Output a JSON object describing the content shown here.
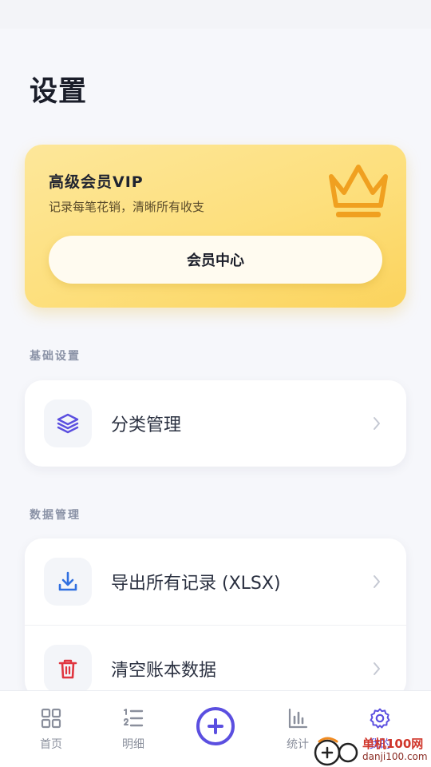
{
  "page": {
    "title": "设置"
  },
  "vip": {
    "title": "高级会员VIP",
    "subtitle": "记录每笔花销，清晰所有收支",
    "button_label": "会员中心",
    "accent": "#f0a020"
  },
  "sections": [
    {
      "label": "基础设置",
      "items": [
        {
          "label": "分类管理",
          "icon": "layers-icon",
          "color": "#5b4fe0"
        }
      ]
    },
    {
      "label": "数据管理",
      "items": [
        {
          "label": "导出所有记录 (XLSX)",
          "icon": "download-icon",
          "color": "#2f6fe0"
        },
        {
          "label": "清空账本数据",
          "icon": "trash-icon",
          "color": "#e0353f"
        }
      ]
    }
  ],
  "tabbar": {
    "items": [
      {
        "label": "首页",
        "icon": "grid-icon"
      },
      {
        "label": "明细",
        "icon": "list-icon"
      },
      {
        "label": "",
        "icon": "add-circle-icon"
      },
      {
        "label": "统计",
        "icon": "bar-chart-icon"
      },
      {
        "label": "我的",
        "icon": "gear-icon",
        "active": true
      }
    ],
    "active_color": "#5b4fe0"
  },
  "watermark": {
    "brand": "单机100网",
    "domain": "danji100.com"
  }
}
